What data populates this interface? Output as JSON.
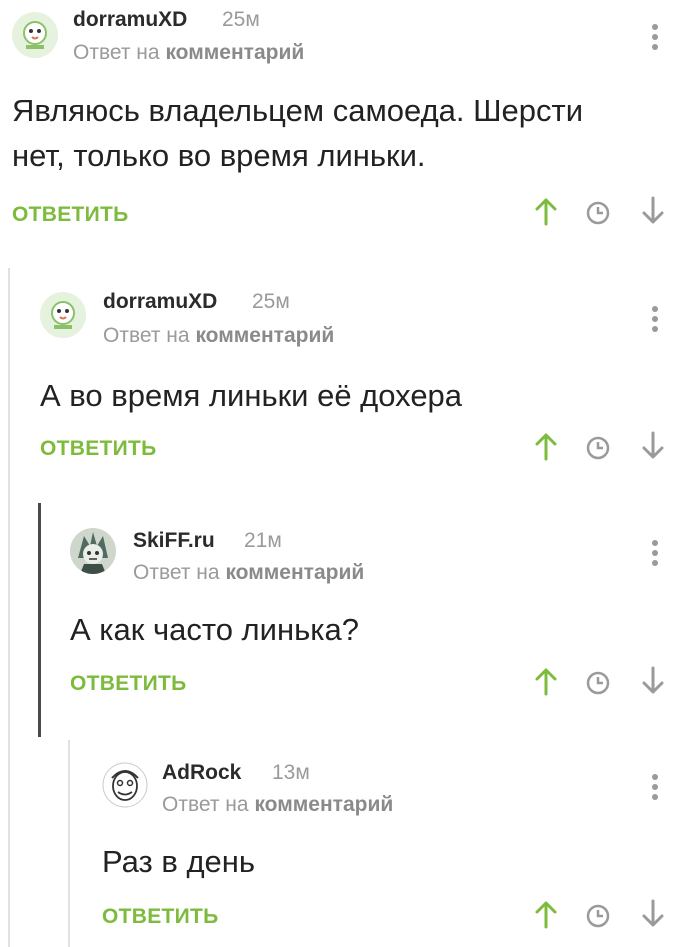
{
  "ui": {
    "reply_label": "ОТВЕТИТЬ",
    "reply_to_prefix": "Ответ на",
    "reply_to_target": "комментарий"
  },
  "colors": {
    "accent": "#7dbb3c",
    "muted": "#9a9a9a",
    "thread_line_dark": "#4a4a4a",
    "thread_line_light": "#dcdcdc"
  },
  "icons": {
    "upvote": "arrow-up-icon",
    "history": "clock-icon",
    "downvote": "arrow-down-icon",
    "menu": "more-vertical-icon"
  },
  "comments": [
    {
      "author": "dorramuXD",
      "time": "25м",
      "text_lines": [
        "Являюсь владельцем самоеда. Шерсти",
        "нет, только во время линьки."
      ]
    },
    {
      "author": "dorramuXD",
      "time": "25м",
      "text_lines": [
        "А во время линьки её дохера"
      ]
    },
    {
      "author": "SkiFF.ru",
      "time": "21м",
      "text_lines": [
        "А как часто линька?"
      ]
    },
    {
      "author": "AdRock",
      "time": "13м",
      "text_lines": [
        "Раз в день"
      ]
    }
  ]
}
